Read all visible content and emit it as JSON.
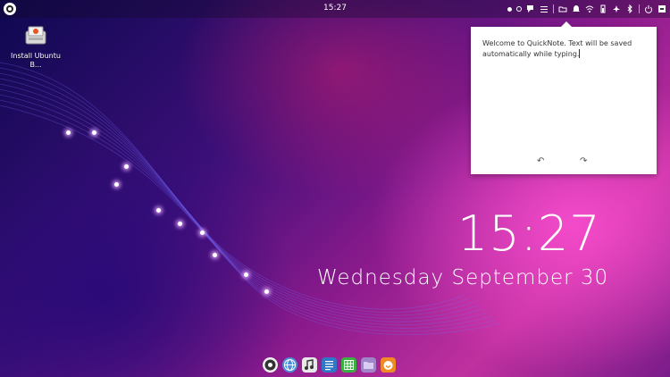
{
  "topbar": {
    "time": "15:27"
  },
  "desktop_icons": [
    {
      "label": "Install Ubuntu B...",
      "icon": "installer-icon"
    }
  ],
  "quicknote": {
    "text": "Welcome to QuickNote. Text will be saved automatically while typing.",
    "undo_icon": "undo-icon",
    "redo_icon": "redo-icon"
  },
  "desktop_clock": {
    "time": "15:27",
    "date": "Wednesday September 30"
  },
  "dock": [
    {
      "name": "ubuntu-budgie-icon",
      "color": "#333333"
    },
    {
      "name": "web-browser-icon",
      "color": "#4a8fd8"
    },
    {
      "name": "music-player-icon",
      "color": "#e8e8e8"
    },
    {
      "name": "text-editor-icon",
      "color": "#2f78c8"
    },
    {
      "name": "spreadsheet-icon",
      "color": "#3cb043"
    },
    {
      "name": "file-manager-icon",
      "color": "#9f86c9"
    },
    {
      "name": "software-center-icon",
      "color": "#f08a24"
    }
  ],
  "colors": {
    "panel": "#140a28",
    "popup_bg": "#ffffff",
    "clock_text": "#ffffff"
  }
}
